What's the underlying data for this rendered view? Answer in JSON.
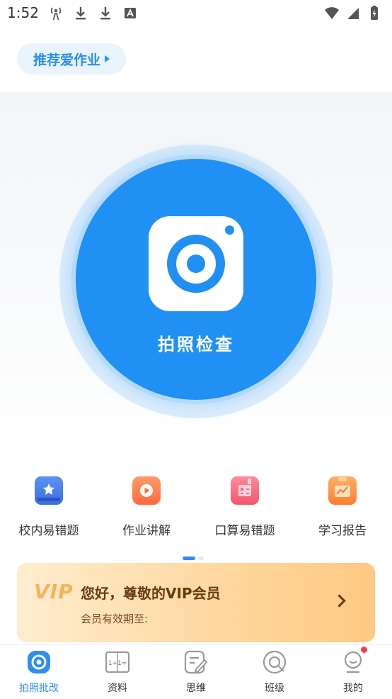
{
  "status_bar": {
    "time": "1:52",
    "left_icons": [
      "broadcast-icon",
      "download-icon",
      "download-icon",
      "font-icon"
    ],
    "right_icons": [
      "wifi-icon",
      "signal-icon",
      "battery-icon"
    ]
  },
  "header": {
    "recommend_label": "推荐爱作业"
  },
  "camera": {
    "label": "拍照检查",
    "accent": "#2090f4"
  },
  "tools": [
    {
      "label": "校内易错题",
      "icon": "book-star-icon",
      "color": "#3a78e8"
    },
    {
      "label": "作业讲解",
      "icon": "play-video-icon",
      "color": "#ff7043"
    },
    {
      "label": "口算易错题",
      "icon": "calculator-book-icon",
      "color": "#f2566d"
    },
    {
      "label": "学习报告",
      "icon": "clipboard-chart-icon",
      "color": "#ff8a3c"
    }
  ],
  "vip": {
    "logo": "VIP",
    "title": "您好，尊敬的VIP会员",
    "subtitle": "会员有效期至:"
  },
  "bottom_nav": [
    {
      "label": "拍照批改",
      "icon": "camera-scan-icon",
      "active": true
    },
    {
      "label": "资料",
      "icon": "book-formula-icon",
      "active": false
    },
    {
      "label": "思维",
      "icon": "note-pen-icon",
      "active": false
    },
    {
      "label": "班级",
      "icon": "class-circle-icon",
      "active": false
    },
    {
      "label": "我的",
      "icon": "profile-icon",
      "active": false
    }
  ]
}
